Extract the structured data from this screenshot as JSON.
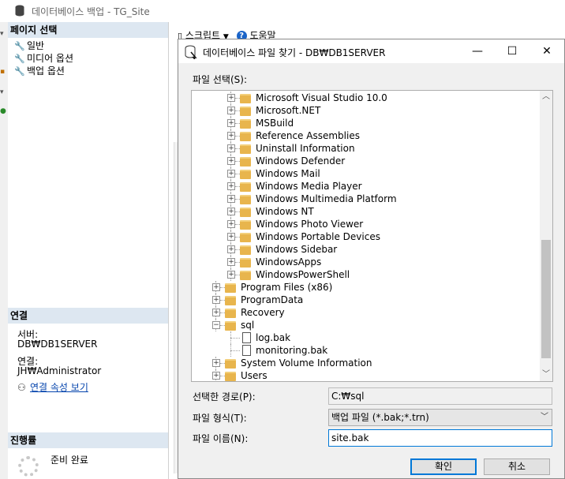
{
  "bg_window": {
    "title": "데이터베이스 백업 - TG_Site",
    "toolbar": {
      "script_label": "스크립트",
      "help_label": "도움말"
    },
    "page_select": {
      "header": "페이지 선택",
      "items": [
        {
          "label": "일반",
          "icon": "wrench-icon"
        },
        {
          "label": "미디어 옵션",
          "icon": "wrench-icon"
        },
        {
          "label": "백업 옵션",
          "icon": "wrench-icon"
        }
      ]
    },
    "connection": {
      "header": "연결",
      "server_label": "서버:",
      "server_value": "DB₩DB1SERVER",
      "conn_label": "연결:",
      "conn_value": "JH₩Administrator",
      "view_props_link": "연결 속성 보기"
    },
    "progress": {
      "header": "진행률",
      "status": "준비 완료"
    }
  },
  "dialog": {
    "title": "데이터베이스 파일 찾기 - DB₩DB1SERVER",
    "select_file_label": "파일 선택(S):",
    "tree_items": [
      {
        "label": "Microsoft Visual Studio 10.0",
        "type": "folder",
        "expander": "+"
      },
      {
        "label": "Microsoft.NET",
        "type": "folder",
        "expander": "+"
      },
      {
        "label": "MSBuild",
        "type": "folder",
        "expander": "+"
      },
      {
        "label": "Reference Assemblies",
        "type": "folder",
        "expander": "+"
      },
      {
        "label": "Uninstall Information",
        "type": "folder",
        "expander": "+"
      },
      {
        "label": "Windows Defender",
        "type": "folder",
        "expander": "+"
      },
      {
        "label": "Windows Mail",
        "type": "folder",
        "expander": "+"
      },
      {
        "label": "Windows Media Player",
        "type": "folder",
        "expander": "+"
      },
      {
        "label": "Windows Multimedia Platform",
        "type": "folder",
        "expander": "+"
      },
      {
        "label": "Windows NT",
        "type": "folder",
        "expander": "+"
      },
      {
        "label": "Windows Photo Viewer",
        "type": "folder",
        "expander": "+"
      },
      {
        "label": "Windows Portable Devices",
        "type": "folder",
        "expander": "+"
      },
      {
        "label": "Windows Sidebar",
        "type": "folder",
        "expander": "+"
      },
      {
        "label": "WindowsApps",
        "type": "folder",
        "expander": "+"
      },
      {
        "label": "WindowsPowerShell",
        "type": "folder",
        "expander": "+"
      },
      {
        "label": "Program Files (x86)",
        "type": "folder",
        "expander": "+"
      },
      {
        "label": "ProgramData",
        "type": "folder",
        "expander": "+"
      },
      {
        "label": "Recovery",
        "type": "folder",
        "expander": "+"
      },
      {
        "label": "sql",
        "type": "folder",
        "expander": "−"
      },
      {
        "label": "log.bak",
        "type": "file",
        "expander": ""
      },
      {
        "label": "monitoring.bak",
        "type": "file",
        "expander": ""
      },
      {
        "label": "System Volume Information",
        "type": "folder",
        "expander": "+"
      },
      {
        "label": "Users",
        "type": "folder",
        "expander": "+"
      }
    ],
    "selected_path_label": "선택한 경로(P):",
    "selected_path_value": "C:₩sql",
    "file_type_label": "파일 형식(T):",
    "file_type_value": "백업 파일 (*.bak;*.trn)",
    "file_name_label": "파일 이름(N):",
    "file_name_value": "site.bak",
    "ok_label": "확인",
    "cancel_label": "취소",
    "minimize_glyph": "—",
    "maximize_glyph": "☐",
    "close_glyph": "✕"
  }
}
